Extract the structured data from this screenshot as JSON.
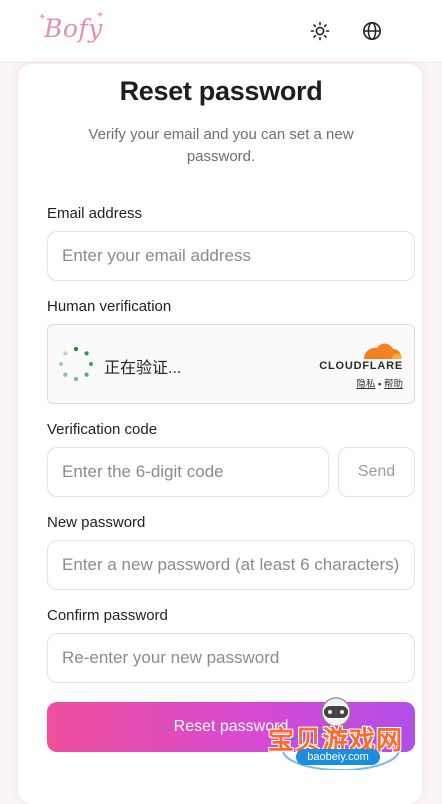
{
  "header": {
    "logo_text": "Bofy",
    "theme_icon": "sun-icon",
    "language_icon": "globe-icon"
  },
  "page": {
    "title": "Reset password",
    "subtitle": "Verify your email and you can set a new password."
  },
  "form": {
    "email": {
      "label": "Email address",
      "placeholder": "Enter your email address"
    },
    "human_verification": {
      "label": "Human verification",
      "status_text": "正在验证...",
      "provider": "CLOUDFLARE",
      "privacy_link": "隐私",
      "separator": "•",
      "help_link": "帮助"
    },
    "verification_code": {
      "label": "Verification code",
      "placeholder": "Enter the 6-digit code",
      "send_label": "Send"
    },
    "new_password": {
      "label": "New password",
      "placeholder": "Enter a new password (at least 6 characters)"
    },
    "confirm_password": {
      "label": "Confirm password",
      "placeholder": "Re-enter your new password"
    },
    "submit_label": "Reset password"
  },
  "watermark": {
    "text": "宝贝游戏网",
    "url": "baobeiy.com"
  },
  "colors": {
    "accent_start": "#ee4f9c",
    "accent_end": "#b04ee6",
    "cloudflare_orange": "#f48120",
    "spinner_green": "#1a8a3a"
  }
}
